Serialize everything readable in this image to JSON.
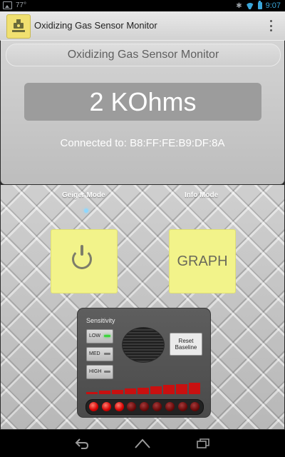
{
  "status_bar": {
    "temperature": "77°",
    "time": "9:07",
    "icons": [
      "image-notification-icon",
      "bluetooth-icon",
      "wifi-icon",
      "battery-icon"
    ]
  },
  "action_bar": {
    "title": "Oxidizing Gas Sensor Monitor",
    "app_icon": "geiger-app-icon",
    "menu_icon": "overflow-menu-icon"
  },
  "monitor": {
    "title": "Oxidizing Gas Sensor Monitor",
    "reading": "2 KOhms",
    "connection": "Connected to: B8:FF:FE:B9:DF:8A"
  },
  "modes": {
    "geiger_label": "Geiger Mode",
    "info_label": "Info Mode",
    "power_icon": "power-icon",
    "graph_label": "GRAPH"
  },
  "geiger": {
    "sensitivity_label": "Sensitivity",
    "sensitivity_options": [
      "LOW",
      "MED",
      "HIGH"
    ],
    "selected_sensitivity": "LOW",
    "reset_label": "Reset Baseline",
    "led_count": 9,
    "leds_lit": 3,
    "bar_segments": 9
  },
  "colors": {
    "button_yellow": "#f2f38a",
    "led_red": "#d40000",
    "indicator_green": "#3fd43f",
    "status_blue": "#3aa6d9"
  },
  "nav_bar": {
    "icons": [
      "back-icon",
      "home-icon",
      "recent-apps-icon"
    ]
  }
}
